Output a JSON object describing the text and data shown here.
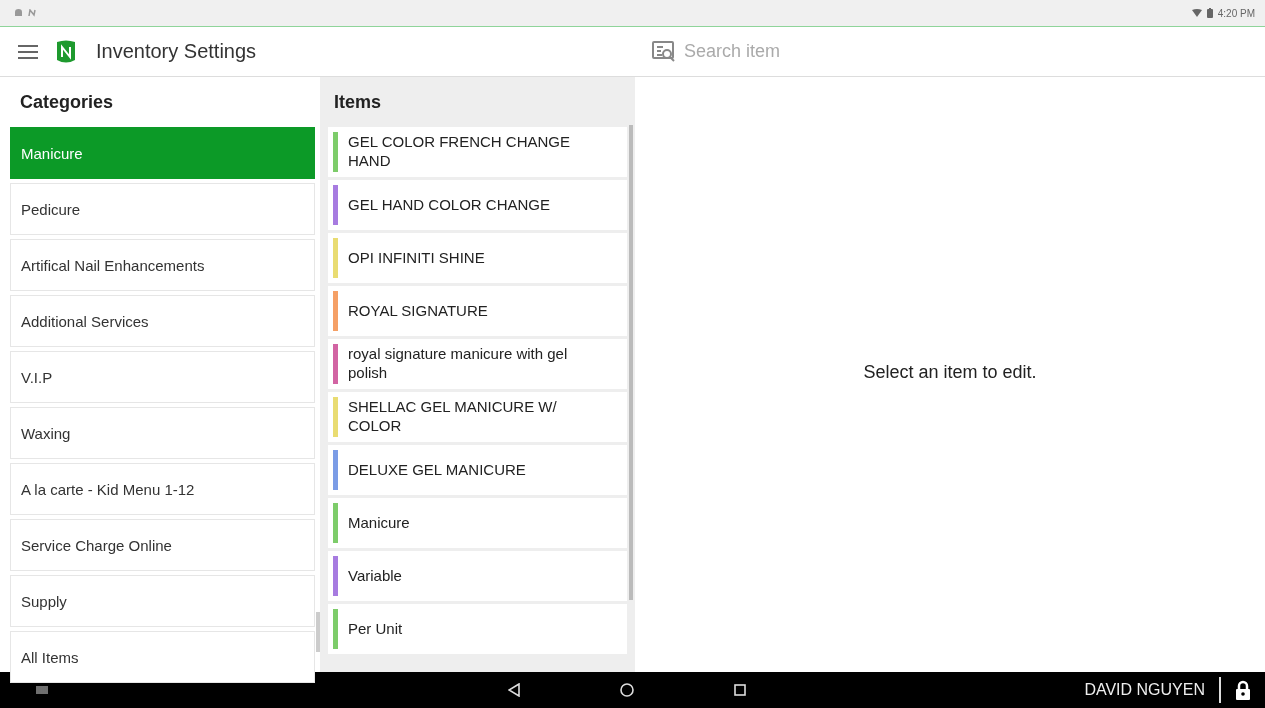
{
  "status_bar": {
    "time": "4:20 PM"
  },
  "app_bar": {
    "title": "Inventory Settings",
    "search": {
      "placeholder": "Search item"
    }
  },
  "categories": {
    "title": "Categories",
    "items": [
      {
        "label": "Manicure",
        "selected": true
      },
      {
        "label": "Pedicure",
        "selected": false
      },
      {
        "label": "Artifical Nail Enhancements",
        "selected": false
      },
      {
        "label": "Additional Services",
        "selected": false
      },
      {
        "label": "V.I.P",
        "selected": false
      },
      {
        "label": "Waxing",
        "selected": false
      },
      {
        "label": "A la carte - Kid Menu 1-12",
        "selected": false
      },
      {
        "label": "Service Charge Online",
        "selected": false
      },
      {
        "label": "Supply",
        "selected": false
      },
      {
        "label": "All Items",
        "selected": false
      }
    ]
  },
  "items": {
    "title": "Items",
    "items": [
      {
        "label": "GEL COLOR FRENCH CHANGE HAND",
        "color": "#7dcc6a"
      },
      {
        "label": "GEL HAND COLOR CHANGE",
        "color": "#a77be0"
      },
      {
        "label": "OPI INFINITI SHINE",
        "color": "#e9dc72"
      },
      {
        "label": "ROYAL SIGNATURE",
        "color": "#f5a066"
      },
      {
        "label": "royal signature manicure with gel polish",
        "color": "#d264a3"
      },
      {
        "label": "SHELLAC GEL MANICURE W/ COLOR",
        "color": "#e9dc72"
      },
      {
        "label": "DELUXE GEL MANICURE",
        "color": "#7b9ce6"
      },
      {
        "label": "Manicure",
        "color": "#7dcc6a"
      },
      {
        "label": "Variable",
        "color": "#a77be0"
      },
      {
        "label": "Per Unit",
        "color": "#7dcc6a"
      }
    ]
  },
  "detail": {
    "message": "Select an item to edit."
  },
  "nav_bar": {
    "user": "DAVID NGUYEN"
  }
}
